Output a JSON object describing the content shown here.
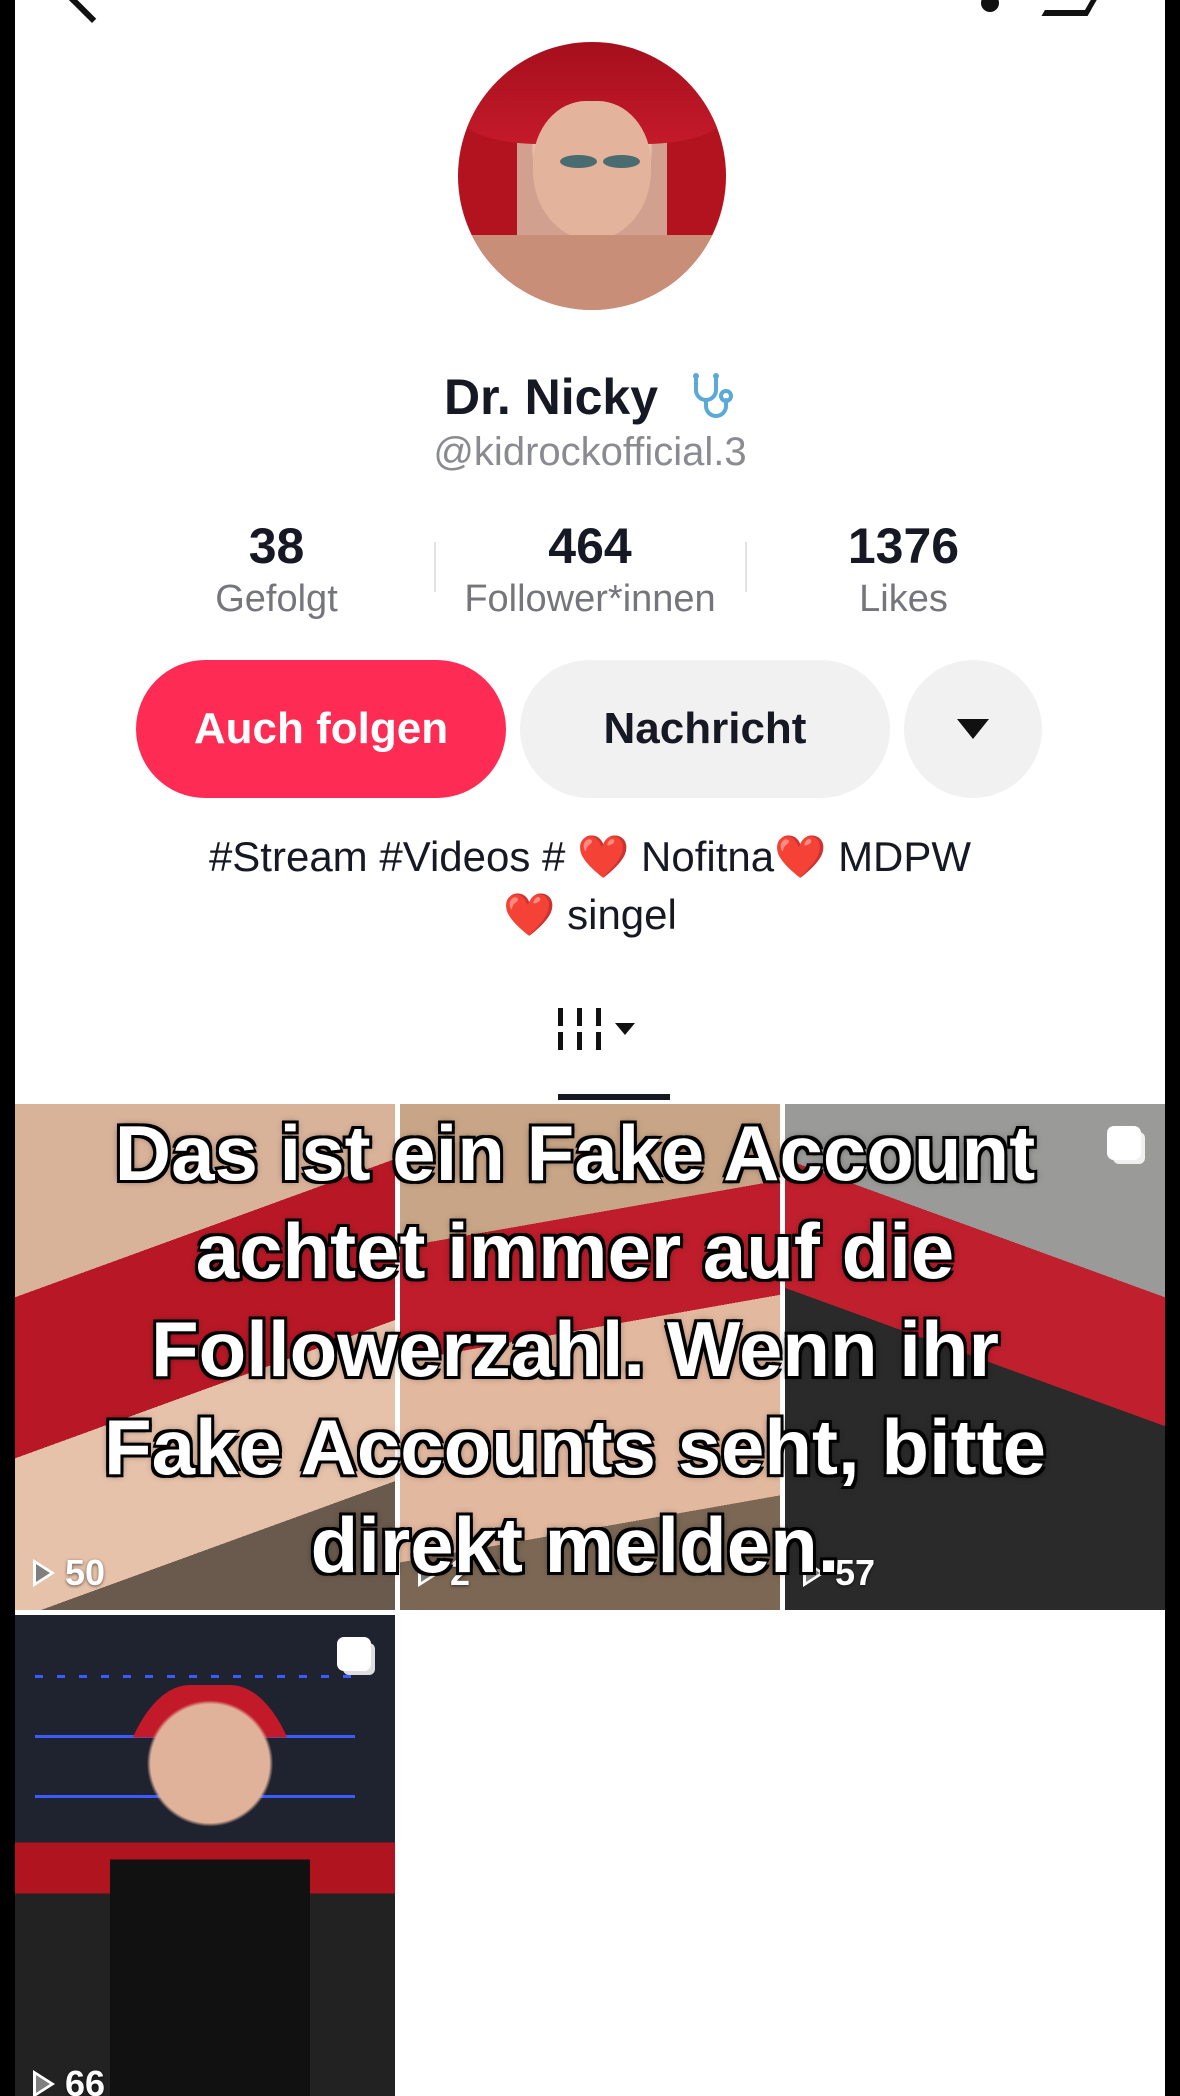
{
  "profile": {
    "display_name": "Dr. Nicky",
    "name_icon": "stethoscope-icon",
    "handle": "@kidrockofficial.3"
  },
  "stats": [
    {
      "value": "38",
      "label": "Gefolgt"
    },
    {
      "value": "464",
      "label": "Follower*innen"
    },
    {
      "value": "1376",
      "label": "Likes"
    }
  ],
  "buttons": {
    "follow_label": "Auch folgen",
    "message_label": "Nachricht",
    "more_icon": "caret-down-icon"
  },
  "bio": {
    "line1_a": "#Stream #Videos # ",
    "heart": "❤️",
    "line1_b": " Nofitna",
    "line1_c": " MDPW",
    "line2": " singel"
  },
  "videos": [
    {
      "views": "50"
    },
    {
      "views": "2"
    },
    {
      "views": "57"
    },
    {
      "views": "66"
    }
  ],
  "overlay": {
    "caption": "Das ist ein Fake Account achtet immer auf die Followerzahl. Wenn ihr Fake Accounts seht, bitte direkt melden."
  },
  "colors": {
    "accent": "#fe2c55",
    "secondary_button": "#f1f1f2",
    "text": "#161823",
    "muted": "#8a8b91"
  }
}
